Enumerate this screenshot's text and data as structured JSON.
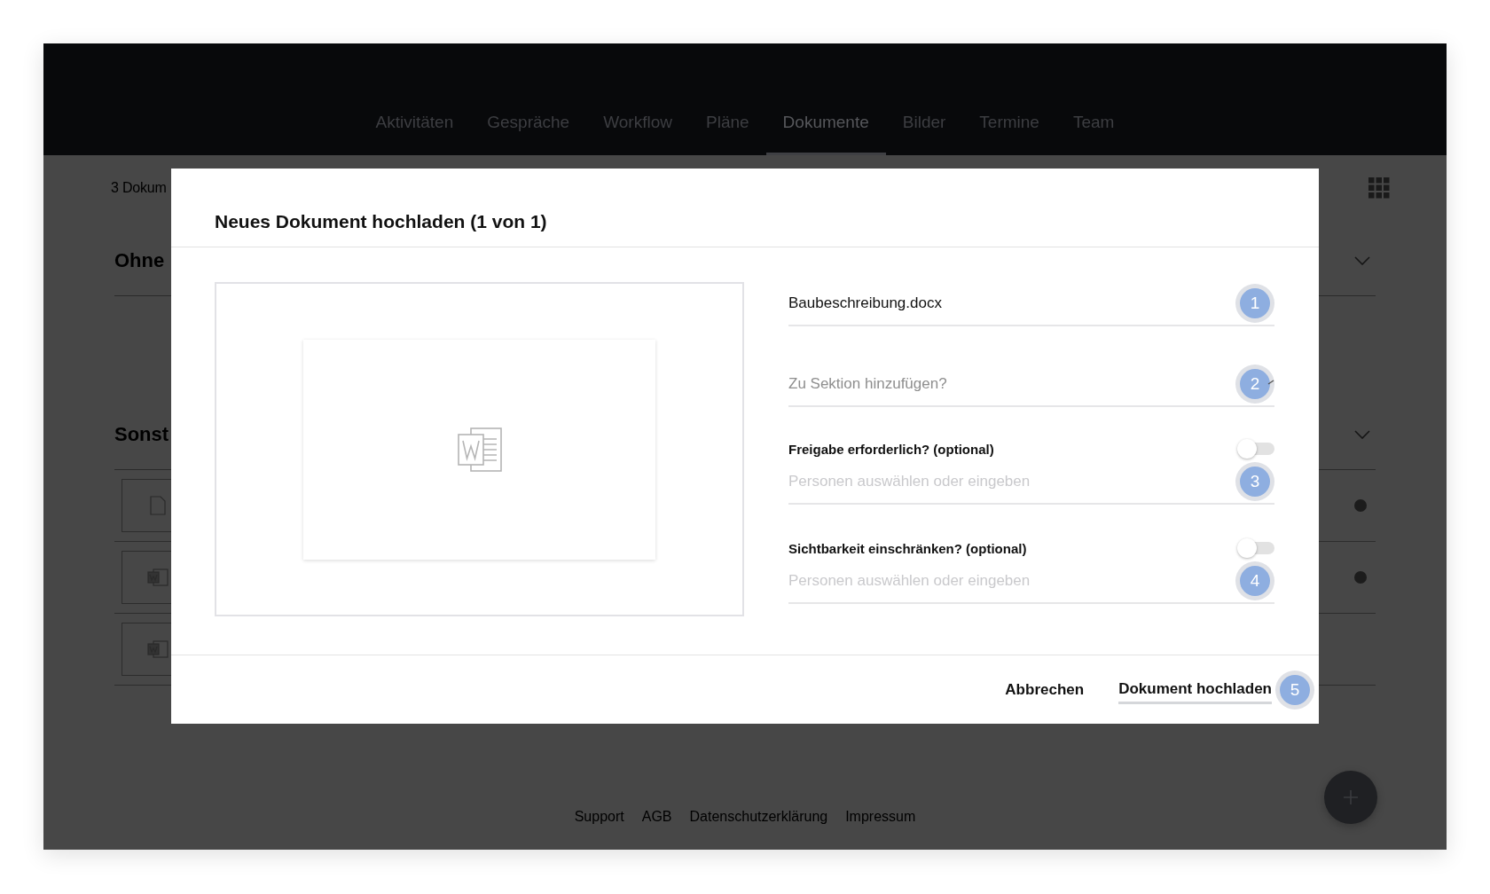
{
  "nav": {
    "tabs": [
      {
        "label": "Aktivitäten",
        "selected": false
      },
      {
        "label": "Gespräche",
        "selected": false
      },
      {
        "label": "Workflow",
        "selected": false
      },
      {
        "label": "Pläne",
        "selected": false
      },
      {
        "label": "Dokumente",
        "selected": true
      },
      {
        "label": "Bilder",
        "selected": false
      },
      {
        "label": "Termine",
        "selected": false
      },
      {
        "label": "Team",
        "selected": false
      }
    ]
  },
  "background": {
    "count_text": "3 Dokum",
    "sections": [
      {
        "title": "Ohne"
      },
      {
        "title": "Sonst",
        "rows": [
          {
            "kind": "file",
            "status_dot": true
          },
          {
            "kind": "word",
            "status_dot": true
          },
          {
            "kind": "word",
            "status_dot": false
          }
        ]
      }
    ]
  },
  "footer_links": [
    "Support",
    "AGB",
    "Datenschutzerklärung",
    "Impressum"
  ],
  "dialog": {
    "title": "Neues Dokument hochladen (1 von 1)",
    "preview": {
      "kind": "word"
    },
    "fields": [
      {
        "kind": "value",
        "value": "Baubeschreibung.docx",
        "step": "1"
      },
      {
        "kind": "select",
        "placeholder": "Zu Sektion hinzufügen?",
        "step": "2"
      },
      {
        "kind": "toggle",
        "label": "Freigabe erforderlich? (optional)",
        "on": false,
        "placeholder": "Personen auswählen oder eingeben",
        "step": "3"
      },
      {
        "kind": "toggle",
        "label": "Sichtbarkeit einschränken? (optional)",
        "on": false,
        "placeholder": "Personen auswählen oder eingeben",
        "step": "4"
      }
    ],
    "buttons": [
      {
        "kind": "text",
        "label": "Abbrechen"
      },
      {
        "kind": "primary",
        "label": "Dokument hochladen",
        "step": "5"
      }
    ]
  }
}
